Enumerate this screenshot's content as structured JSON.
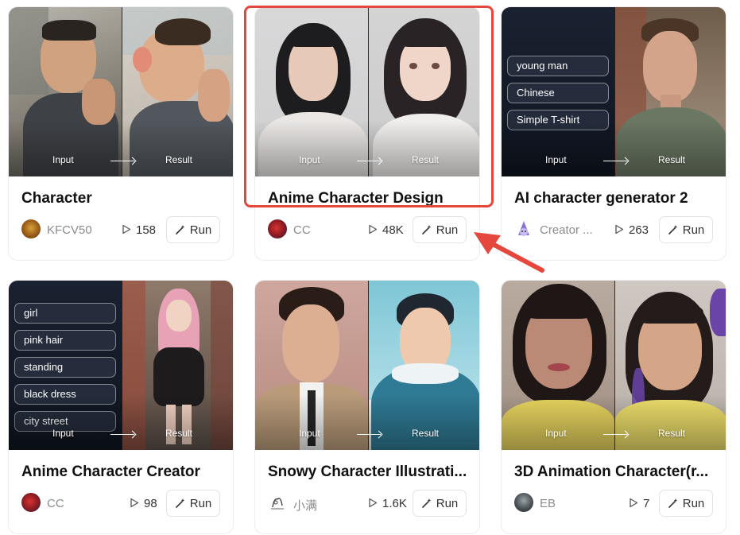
{
  "labels": {
    "input": "Input",
    "result": "Result",
    "run": "Run"
  },
  "cards": [
    {
      "title": "Character",
      "author": "KFCV50",
      "runs": "158",
      "chips": []
    },
    {
      "title": "Anime Character Design",
      "author": "CC",
      "runs": "48K",
      "chips": []
    },
    {
      "title": "AI character generator 2",
      "author": "Creator ...",
      "runs": "263",
      "chips": [
        "young man",
        "Chinese",
        "Simple T-shirt"
      ]
    },
    {
      "title": "Anime Character Creator",
      "author": "CC",
      "runs": "98",
      "chips": [
        "girl",
        "pink hair",
        "standing",
        "black dress",
        "city street"
      ]
    },
    {
      "title": "Snowy Character Illustrati...",
      "author": "小满",
      "runs": "1.6K",
      "chips": []
    },
    {
      "title": "3D Animation Character(r...",
      "author": "EB",
      "runs": "7",
      "chips": []
    }
  ],
  "icons": {
    "play": "play-icon",
    "run": "magic-wand-icon",
    "arrow": "arrow-right-icon"
  },
  "colors": {
    "highlight": "#e5473d",
    "title": "#111111",
    "muted": "#8c8c8c"
  }
}
